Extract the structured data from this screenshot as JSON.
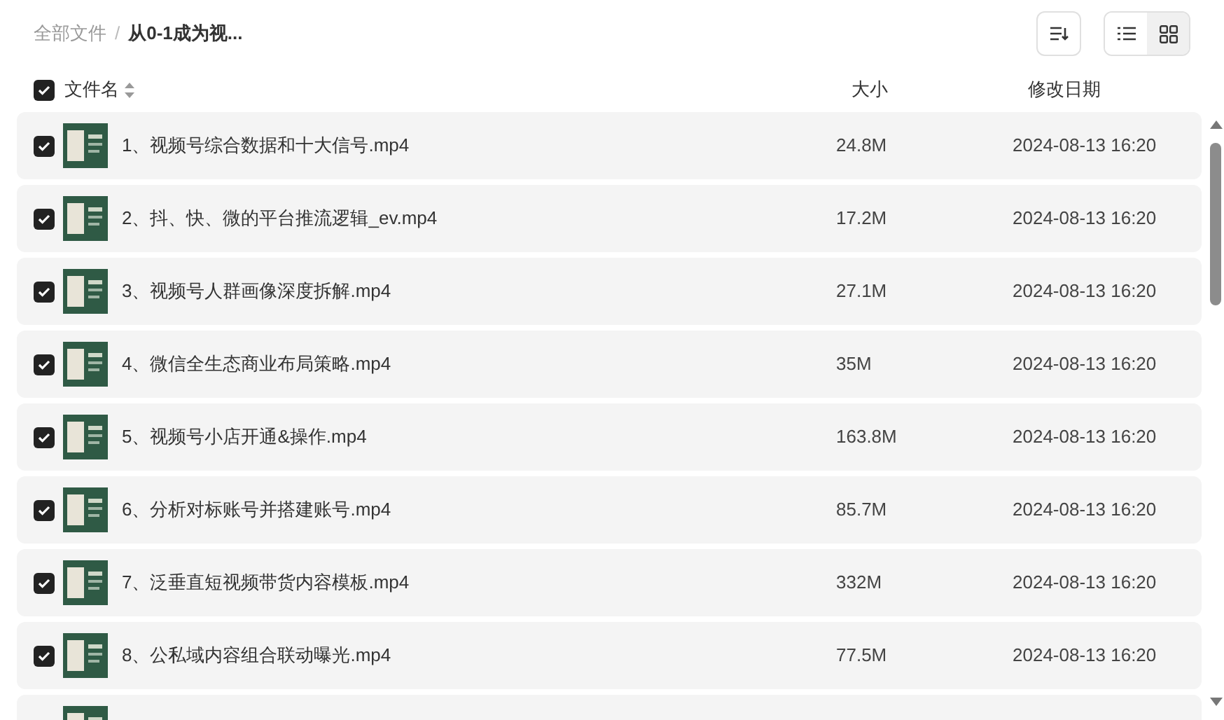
{
  "breadcrumb": {
    "separator": "/",
    "items": [
      {
        "label": "全部文件",
        "current": false
      },
      {
        "label": "从0-1成为视...",
        "current": true
      }
    ]
  },
  "view_toggle": [
    {
      "kind": "list",
      "selected": false
    },
    {
      "kind": "grid",
      "selected": true
    }
  ],
  "table": {
    "select_all": {
      "checked": true
    },
    "columns": [
      "文件名",
      "大小",
      "修改日期"
    ],
    "rows": [
      {
        "name": "1、视频号综合数据和十大信号.mp4",
        "size": "24.8M",
        "date": "2024-08-13 16:20",
        "checked": true
      },
      {
        "name": "2、抖、快、微的平台推流逻辑_ev.mp4",
        "size": "17.2M",
        "date": "2024-08-13 16:20",
        "checked": true
      },
      {
        "name": "3、视频号人群画像深度拆解.mp4",
        "size": "27.1M",
        "date": "2024-08-13 16:20",
        "checked": true
      },
      {
        "name": "4、微信全生态商业布局策略.mp4",
        "size": "35M",
        "date": "2024-08-13 16:20",
        "checked": true
      },
      {
        "name": "5、视频号小店开通&操作.mp4",
        "size": "163.8M",
        "date": "2024-08-13 16:20",
        "checked": true
      },
      {
        "name": "6、分析对标账号并搭建账号.mp4",
        "size": "85.7M",
        "date": "2024-08-13 16:20",
        "checked": true
      },
      {
        "name": "7、泛垂直短视频带货内容模板.mp4",
        "size": "332M",
        "date": "2024-08-13 16:20",
        "checked": true
      },
      {
        "name": "8、公私域内容组合联动曝光.mp4",
        "size": "77.5M",
        "date": "2024-08-13 16:20",
        "checked": true
      }
    ]
  }
}
